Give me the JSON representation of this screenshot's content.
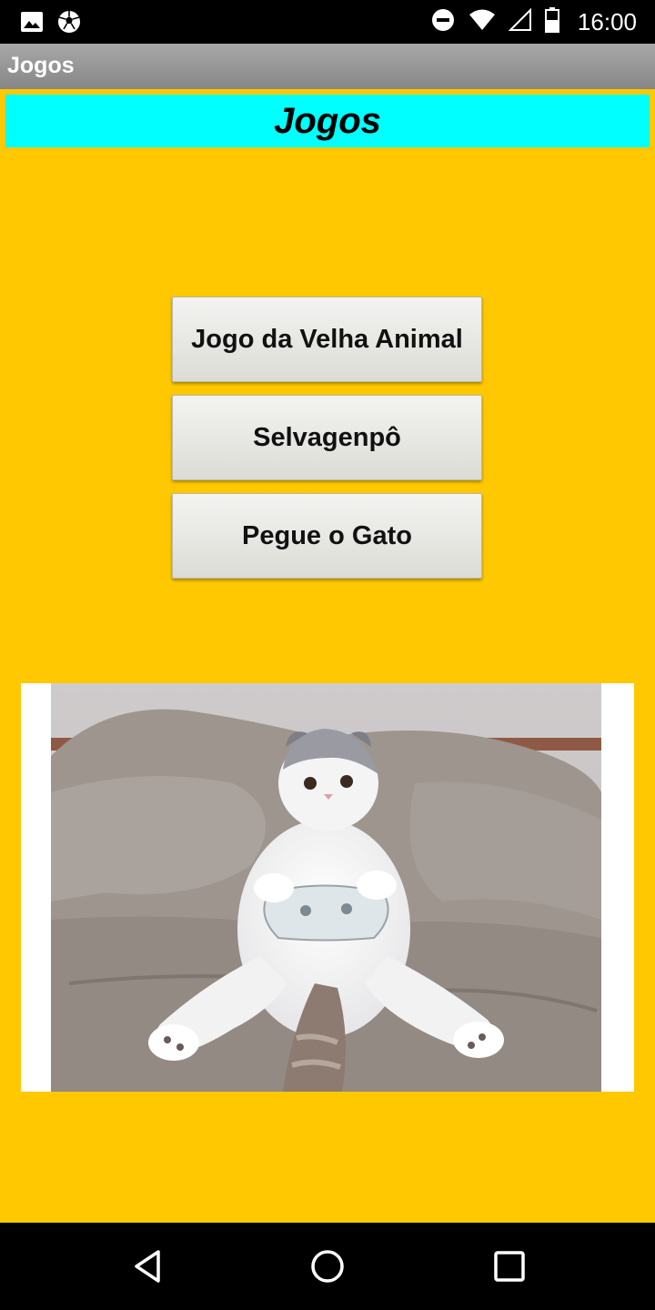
{
  "status_bar": {
    "time": "16:00",
    "left_icons": [
      "image-icon",
      "soccer-ball-icon"
    ],
    "right_icons": [
      "do-not-disturb-icon",
      "wifi-icon",
      "signal-icon",
      "battery-icon"
    ]
  },
  "app_bar": {
    "title": "Jogos"
  },
  "header": {
    "title": "Jogos",
    "background": "#00ffff"
  },
  "buttons": [
    {
      "label": "Jogo da Velha Animal"
    },
    {
      "label": "Selvagenpô"
    },
    {
      "label": "Pegue o Gato"
    }
  ],
  "image": {
    "subject": "cat-playing-video-game"
  },
  "nav_bar": {
    "icons": [
      "back-icon",
      "home-icon",
      "recents-icon"
    ]
  },
  "colors": {
    "background": "#ffc800",
    "header": "#00ffff",
    "app_bar": "#979797"
  }
}
